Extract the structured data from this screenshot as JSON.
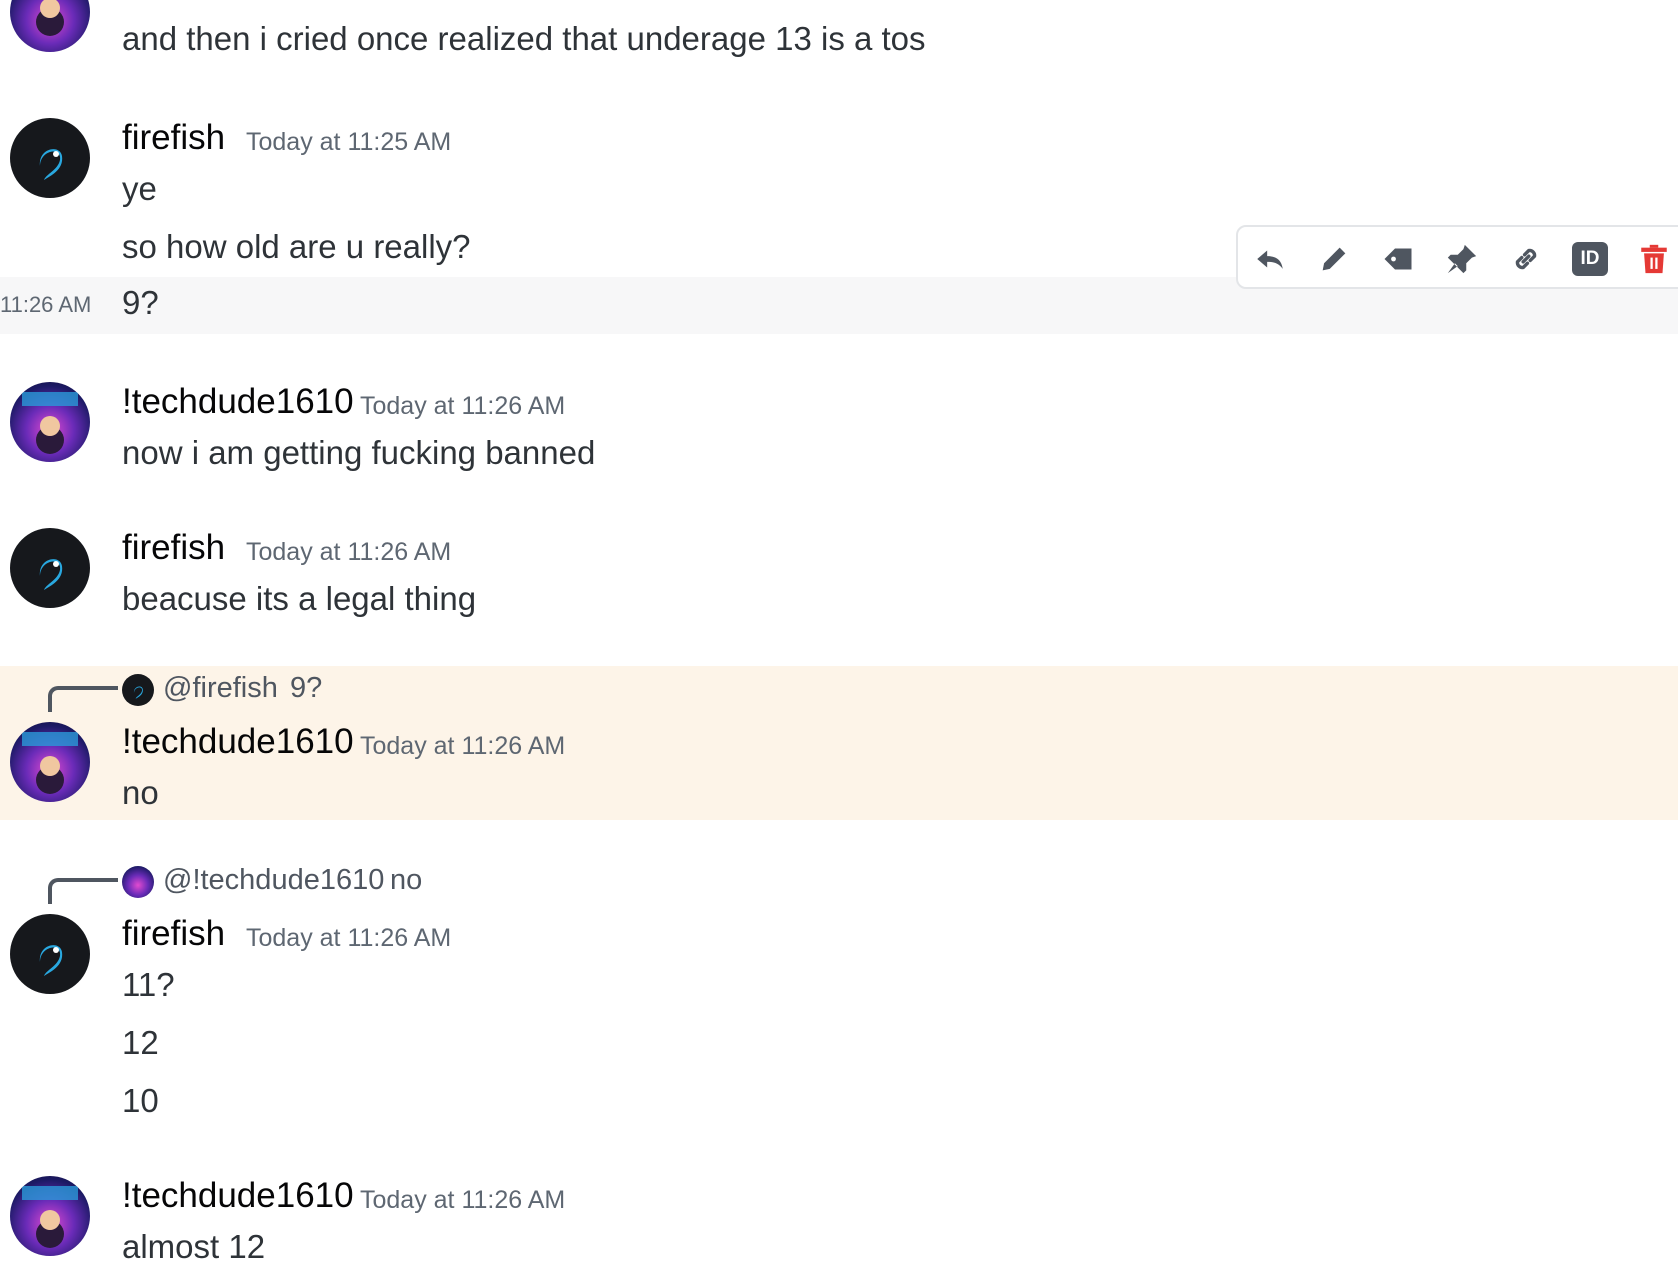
{
  "messages": {
    "m0": {
      "text": "and then i cried once realized that underage 13 is a tos"
    },
    "m1": {
      "author": "firefish",
      "timestamp": "Today at 11:25 AM",
      "lines": [
        "ye",
        "so how old are u really?"
      ]
    },
    "m1b": {
      "hover_time": "11:26 AM",
      "text": "9?"
    },
    "m2": {
      "author": "!techdude1610",
      "timestamp": "Today at 11:26 AM",
      "text": "now i am getting fucking banned"
    },
    "m3": {
      "author": "firefish",
      "timestamp": "Today at 11:26 AM",
      "text": "beacuse its a legal thing"
    },
    "m4": {
      "reply_author": "@firefish",
      "reply_text": "9?",
      "author": "!techdude1610",
      "timestamp": "Today at 11:26 AM",
      "text": "no"
    },
    "m5": {
      "reply_author": "@!techdude1610",
      "reply_text": "no",
      "author": "firefish",
      "timestamp": "Today at 11:26 AM",
      "lines": [
        "11?",
        "12",
        "10"
      ]
    },
    "m6": {
      "author": "!techdude1610",
      "timestamp": "Today at 11:26 AM",
      "text": "almost 12"
    }
  },
  "toolbar": {
    "icons": [
      "reply-icon",
      "edit-icon",
      "tag-icon",
      "pin-icon",
      "link-icon",
      "id-icon",
      "delete-icon"
    ],
    "id_label": "ID"
  },
  "colors": {
    "highlight": "#fdf4e8",
    "delete": "#e53935",
    "icon": "#4f5660"
  }
}
